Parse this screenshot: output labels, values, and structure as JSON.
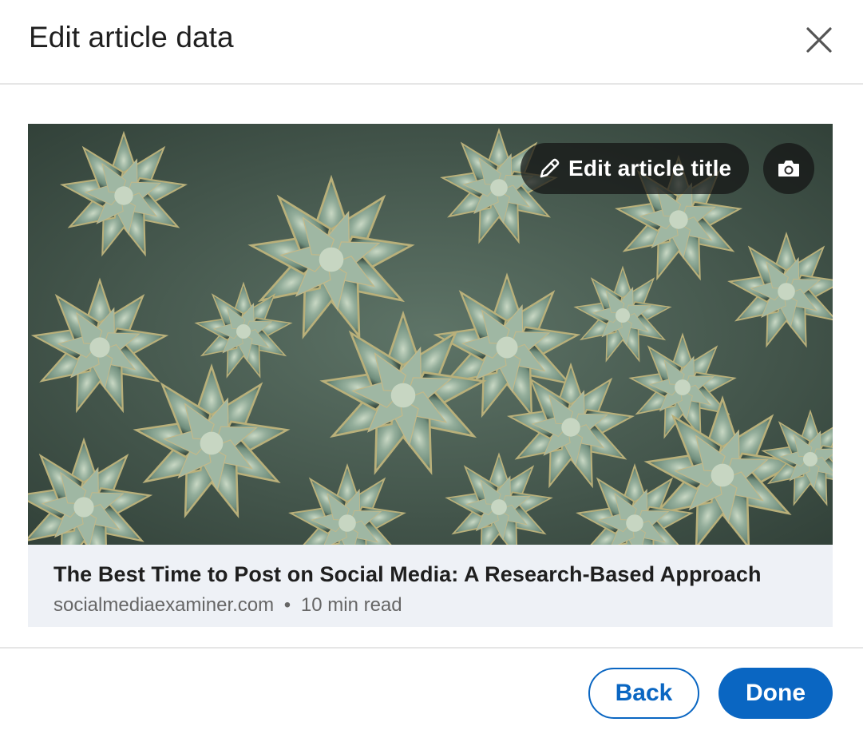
{
  "dialog": {
    "title": "Edit article data"
  },
  "preview": {
    "edit_title_label": "Edit article title",
    "article_title": "The Best Time to Post on Social Media: A Research-Based Approach",
    "domain": "socialmediaexaminer.com",
    "separator": "•",
    "read_time": "10 min read",
    "icons": {
      "close": "close-icon",
      "pencil": "pencil-icon",
      "camera": "camera-icon"
    }
  },
  "footer": {
    "back_label": "Back",
    "done_label": "Done"
  },
  "colors": {
    "accent": "#0a66c2",
    "info_bg": "#eef1f6",
    "pill_bg": "#141414"
  }
}
